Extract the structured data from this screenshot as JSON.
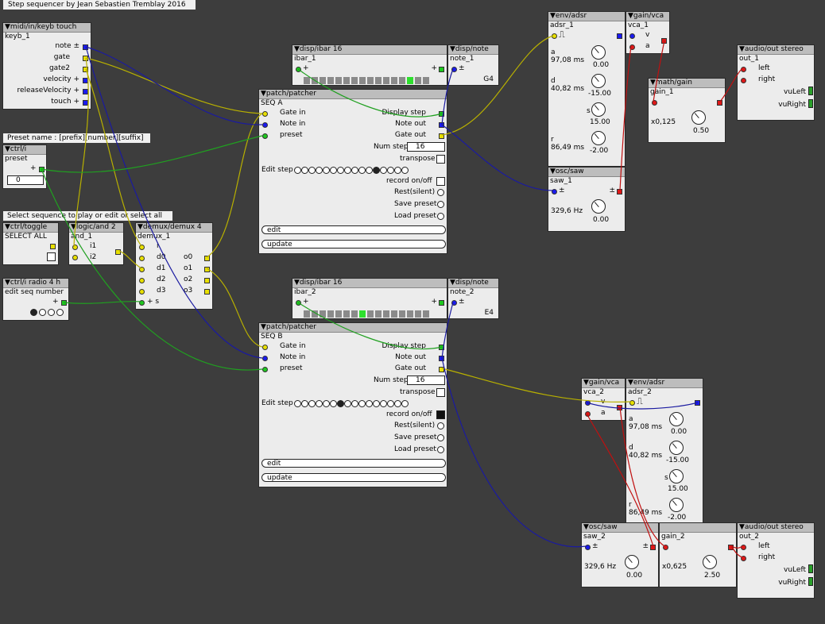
{
  "title": "Step sequencer by Jean Sebastien Tremblay 2016",
  "comments": {
    "preset_name": "Preset name : [prefix][number][suffix]",
    "select_seq": "Select sequence to play or edit or select all"
  },
  "keyb": {
    "type": "▼midi/in/keyb touch",
    "name": "keyb_1",
    "outs": [
      "note ±",
      "gate",
      "gate2",
      "velocity +",
      "releaseVelocity +",
      "touch +"
    ]
  },
  "ctrl_i": {
    "type": "▼ctrl/i",
    "name": "preset",
    "value": "0",
    "plus": "+"
  },
  "toggle": {
    "type": "▼ctrl/toggle",
    "name": "SELECT ALL"
  },
  "and": {
    "type": "▼logic/and 2",
    "name": "and_1",
    "i1": "i1",
    "i2": "i2"
  },
  "demux": {
    "type": "▼demux/demux 4",
    "name": "demux_1",
    "inputs": [
      "i",
      "d0",
      "d1",
      "d2",
      "d3",
      "+ s"
    ],
    "outputs": [
      "o0",
      "o1",
      "o2",
      "o3"
    ]
  },
  "radio": {
    "type": "▼ctrl/i radio 4 h",
    "name": "edit seq number",
    "plus": "+"
  },
  "ibar1": {
    "type": "▼disp/ibar 16",
    "name": "ibar_1",
    "plus": "+"
  },
  "note1": {
    "type": "▼disp/note",
    "name": "note_1",
    "value": "G4",
    "pm": "±"
  },
  "ibar2": {
    "type": "▼disp/ibar 16",
    "name": "ibar_2",
    "plus": "+"
  },
  "note2": {
    "type": "▼disp/note",
    "name": "note_2",
    "value": "E4",
    "pm": "±"
  },
  "seqA": {
    "type": "▼patch/patcher",
    "name": "SEQ A",
    "in_gate": "Gate in",
    "in_note": "Note in",
    "in_preset": "preset",
    "display_step": "Display step",
    "note_out": "Note out",
    "gate_out": "Gate out",
    "num_step_label": "Num step",
    "num_step": "16",
    "transpose": "transpose",
    "edit_step": "Edit step",
    "record": "record on/off",
    "rest": "Rest(silent)",
    "save": "Save preset",
    "load": "Load preset",
    "edit": "edit",
    "update": "update"
  },
  "seqB": {
    "type": "▼patch/patcher",
    "name": "SEQ B",
    "in_gate": "Gate in",
    "in_note": "Note in",
    "in_preset": "preset",
    "display_step": "Display step",
    "note_out": "Note out",
    "gate_out": "Gate out",
    "num_step_label": "Num step",
    "num_step": "16",
    "transpose": "transpose",
    "edit_step": "Edit step",
    "record": "record on/off",
    "rest": "Rest(silent)",
    "save": "Save preset",
    "load": "Load preset",
    "edit": "edit",
    "update": "update"
  },
  "adsr1": {
    "type": "▼env/adsr",
    "name": "adsr_1",
    "a_label": "a",
    "a": "97,08 ms",
    "a_val": "0.00",
    "d_label": "d",
    "d": "40,82 ms",
    "d_val": "-15.00",
    "s_label": "s",
    "s_val": "15.00",
    "r_label": "r",
    "r": "86,49 ms",
    "r_val": "-2.00"
  },
  "vca1": {
    "type": "▼gain/vca",
    "name": "vca_1",
    "v": "v",
    "a": "a"
  },
  "saw1": {
    "type": "▼osc/saw",
    "name": "saw_1",
    "freq": "329,6 Hz",
    "val": "0.00",
    "pm": "±"
  },
  "gain1": {
    "type": "▼math/gain",
    "name": "gain_1",
    "mult": "x0,125",
    "val": "0.50"
  },
  "out1": {
    "type": "▼audio/out stereo",
    "name": "out_1",
    "left": "left",
    "right": "right",
    "vuL": "vuLeft",
    "vuR": "vuRight"
  },
  "vca2": {
    "type": "▼gain/vca",
    "name": "vca_2",
    "v": "v",
    "a": "a"
  },
  "adsr2": {
    "type": "▼env/adsr",
    "name": "adsr_2",
    "a_label": "a",
    "a": "97,08 ms",
    "a_val": "0.00",
    "d_label": "d",
    "d": "40,82 ms",
    "d_val": "-15.00",
    "s_label": "s",
    "s_val": "15.00",
    "r_label": "r",
    "r": "86,49 ms",
    "r_val": "-2.00"
  },
  "saw2": {
    "type": "▼osc/saw",
    "name": "saw_2",
    "freq": "329,6 Hz",
    "val": "0.00",
    "pm": "±"
  },
  "gain2": {
    "type": "",
    "name": "gain_2",
    "mult": "x0,625",
    "val": "2.50"
  },
  "out2": {
    "type": "▼audio/out stereo",
    "name": "out_2",
    "left": "left",
    "right": "right",
    "vuL": "vuLeft",
    "vuR": "vuRight"
  },
  "ibar1_active": 13,
  "ibar2_active": 7,
  "seqA_active_step": 11,
  "seqB_active_step": 6,
  "colors": {
    "background": "#3d3d3d",
    "wire_yellow": "#b8b000",
    "wire_blue": "#1a1aa0",
    "wire_green": "#20a020",
    "wire_red": "#c01010"
  }
}
